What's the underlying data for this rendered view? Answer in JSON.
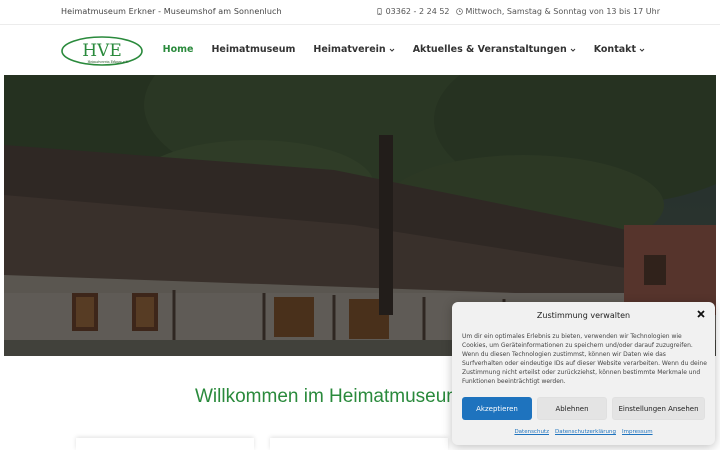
{
  "topbar": {
    "site_tagline": "Heimatmuseum Erkner - Museumshof am Sonnenluch",
    "phone": "03362 - 2 24 52",
    "opening_hours": "Mittwoch, Samstag & Sonntag von 13 bis 17 Uhr",
    "phone_icon": "phone-icon",
    "clock_icon": "clock-icon"
  },
  "logo": {
    "letters": "HVE",
    "caption": "Heimatverein Erkner e.V."
  },
  "nav": {
    "items": [
      {
        "label": "Home",
        "active": true
      },
      {
        "label": "Heimatmuseum"
      },
      {
        "label": "Heimatverein",
        "dropdown": true
      },
      {
        "label": "Aktuelles & Veranstaltungen",
        "dropdown": true
      },
      {
        "label": "Kontakt",
        "dropdown": true
      }
    ]
  },
  "main": {
    "welcome_title": "Willkommen im Heimatmuseum"
  },
  "consent": {
    "title": "Zustimmung verwalten",
    "text": "Um dir ein optimales Erlebnis zu bieten, verwenden wir Technologien wie Cookies, um Geräteinformationen zu speichern und/oder darauf zuzugreifen. Wenn du diesen Technologien zustimmst, können wir Daten wie das Surfverhalten oder eindeutige IDs auf dieser Website verarbeiten. Wenn du deine Zustimmung nicht erteilst oder zurückziehst, können bestimmte Merkmale und Funktionen beeinträchtigt werden.",
    "accept_label": "Akzeptieren",
    "deny_label": "Ablehnen",
    "preferences_label": "Einstellungen Ansehen",
    "links": [
      "Datenschutz",
      "Datenschutzerklärung",
      "Impressum"
    ]
  },
  "colors": {
    "brand_green": "#2a8a3c",
    "accept_blue": "#1e73be"
  }
}
